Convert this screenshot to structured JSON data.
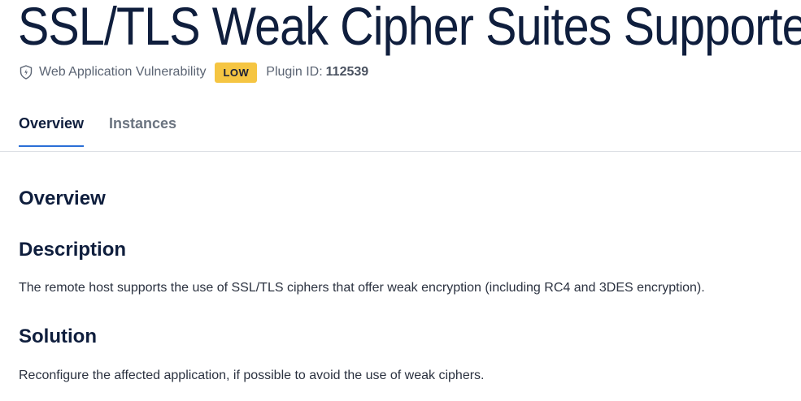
{
  "header": {
    "title": "SSL/TLS Weak Cipher Suites Supported",
    "category": "Web Application Vulnerability",
    "category_icon": "shield-icon",
    "severity": "LOW",
    "severity_color": "#f5c542",
    "plugin_id_label": "Plugin ID:",
    "plugin_id": "112539"
  },
  "tabs": [
    {
      "label": "Overview",
      "active": true
    },
    {
      "label": "Instances",
      "active": false
    }
  ],
  "content": {
    "overview_heading": "Overview",
    "description_heading": "Description",
    "description_text": "The remote host supports the use of SSL/TLS ciphers that offer weak encryption (including RC4 and 3DES encryption).",
    "solution_heading": "Solution",
    "solution_text": "Reconfigure the affected application, if possible to avoid the use of weak ciphers."
  },
  "colors": {
    "accent": "#2a6fd6",
    "title": "#0f1e3d"
  }
}
